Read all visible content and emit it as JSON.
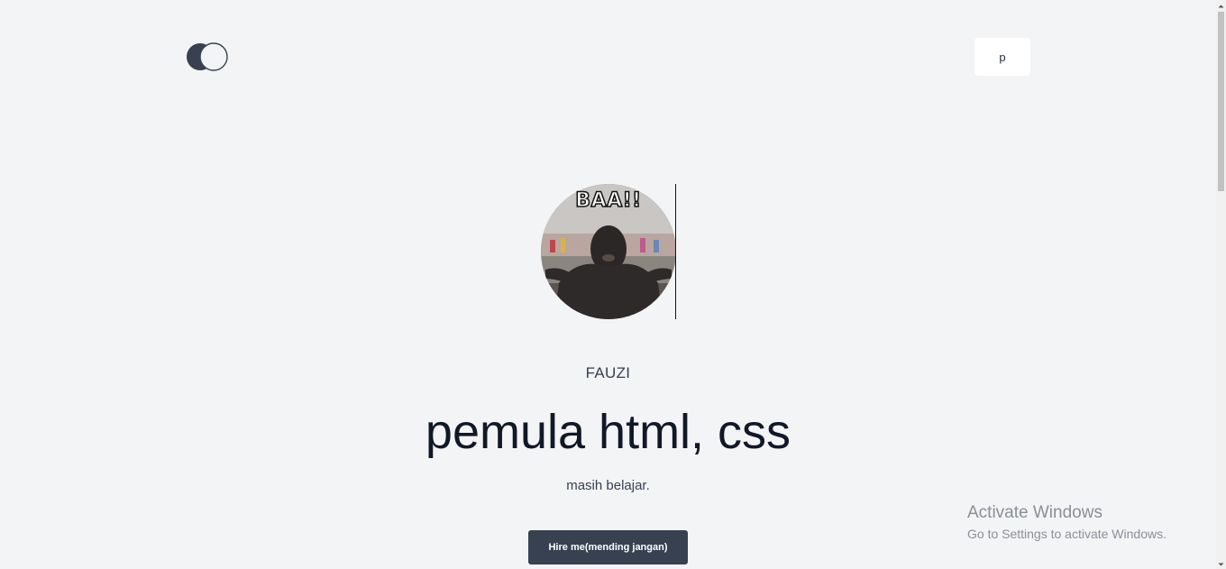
{
  "header": {
    "logo_icon": "overlapping-circles-logo",
    "menu_button_label": "p"
  },
  "hero": {
    "avatar_caption": "BAA!!",
    "name": "FAUZI",
    "headline": "pemula html, css",
    "subtitle": "masih belajar.",
    "cta_label": "Hire me(mending jangan)"
  },
  "watermark": {
    "title": "Activate Windows",
    "subtitle": "Go to Settings to activate Windows."
  },
  "colors": {
    "background": "#f3f4f6",
    "dark": "#374151",
    "text": "#111827"
  }
}
